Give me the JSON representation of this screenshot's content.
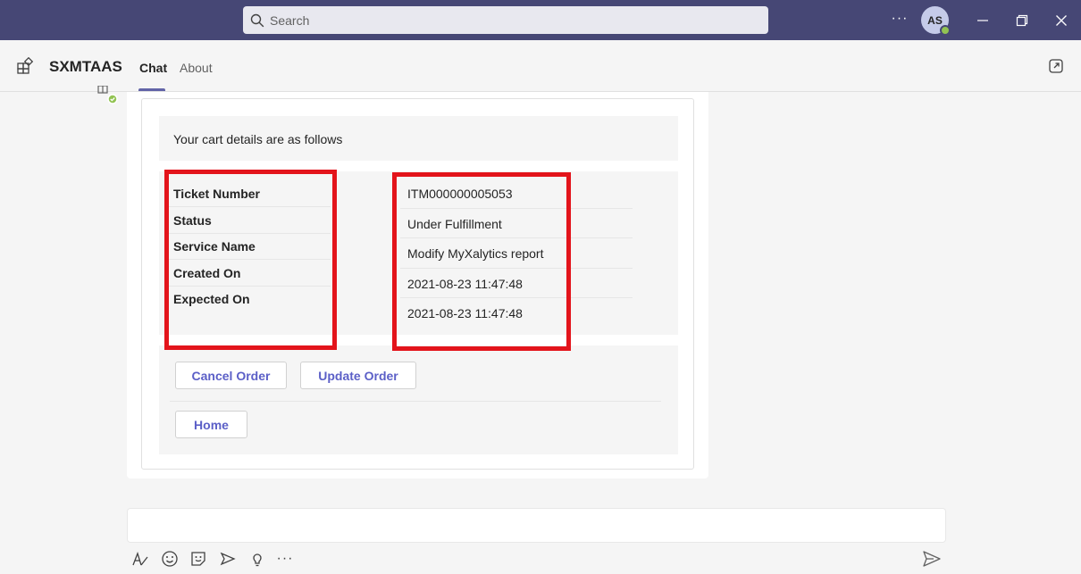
{
  "titlebar": {
    "search_placeholder": "Search",
    "more_label": "···",
    "avatar_initials": "AS"
  },
  "app": {
    "name": "SXMTAAS",
    "tabs": [
      {
        "label": "Chat",
        "active": true
      },
      {
        "label": "About",
        "active": false
      }
    ]
  },
  "card": {
    "header": "Your cart details are as follows",
    "facts": [
      {
        "label": "Ticket Number",
        "value": "ITM000000005053"
      },
      {
        "label": "Status",
        "value": "Under Fulfillment"
      },
      {
        "label": "Service Name",
        "value": "Modify MyXalytics report"
      },
      {
        "label": "Created On",
        "value": "2021-08-23 11:47:48"
      },
      {
        "label": "Expected On",
        "value": "2021-08-23 11:47:48"
      }
    ],
    "actions": {
      "cancel_label": "Cancel Order",
      "update_label": "Update Order",
      "home_label": "Home"
    }
  },
  "composer": {
    "value": "",
    "more_label": "···"
  },
  "colors": {
    "titlebar": "#464775",
    "accent": "#6264a7",
    "button_text": "#5b5fc7",
    "annotation": "#e3141b",
    "presence": "#92c353"
  }
}
